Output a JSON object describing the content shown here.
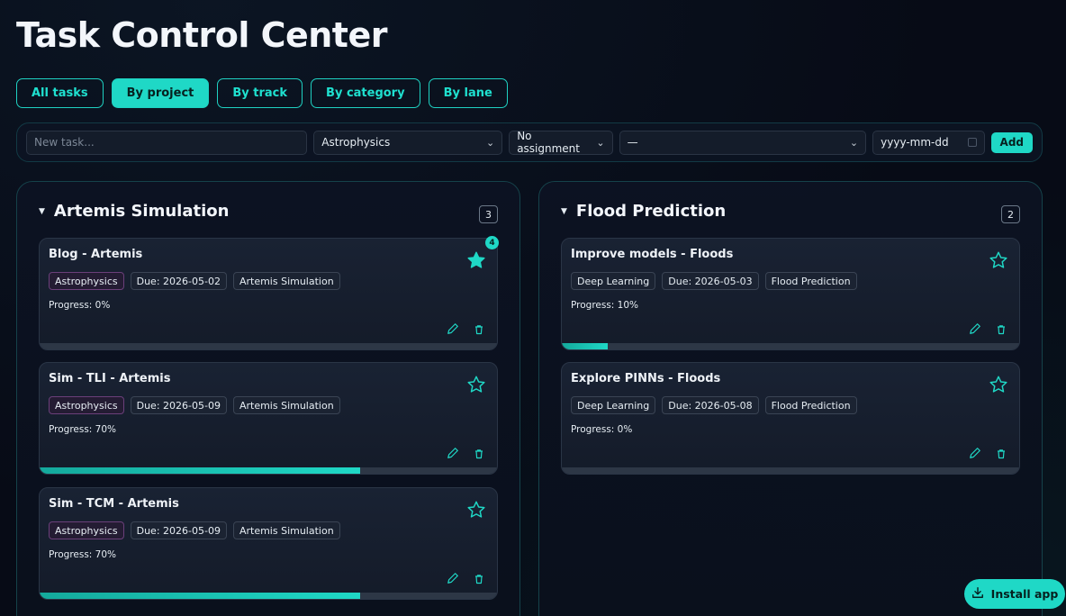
{
  "app": {
    "title": "Task Control Center"
  },
  "view_tabs": [
    {
      "label": "All tasks",
      "active": false
    },
    {
      "label": "By project",
      "active": true
    },
    {
      "label": "By track",
      "active": false
    },
    {
      "label": "By category",
      "active": false
    },
    {
      "label": "By lane",
      "active": false
    }
  ],
  "add_bar": {
    "task_placeholder": "New task...",
    "category_value": "Astrophysics",
    "assignment_value": "No assignment",
    "project_value": "—",
    "date_placeholder": "yyyy-mm-dd",
    "add_label": "Add"
  },
  "columns": [
    {
      "title": "Artemis Simulation",
      "count": "3",
      "cards": [
        {
          "title": "Blog - Artemis",
          "category": "Astrophysics",
          "due": "Due: 2026-05-02",
          "project": "Artemis Simulation",
          "progress_text": "Progress: 0%",
          "progress": 0,
          "starred": true,
          "badge": "4"
        },
        {
          "title": "Sim - TLI - Artemis",
          "category": "Astrophysics",
          "due": "Due: 2026-05-09",
          "project": "Artemis Simulation",
          "progress_text": "Progress: 70%",
          "progress": 70,
          "starred": false
        },
        {
          "title": "Sim - TCM - Artemis",
          "category": "Astrophysics",
          "due": "Due: 2026-05-09",
          "project": "Artemis Simulation",
          "progress_text": "Progress: 70%",
          "progress": 70,
          "starred": false
        }
      ]
    },
    {
      "title": "Flood Prediction",
      "count": "2",
      "cards": [
        {
          "title": "Improve models - Floods",
          "category": "Deep Learning",
          "due": "Due: 2026-05-03",
          "project": "Flood Prediction",
          "progress_text": "Progress: 10%",
          "progress": 10,
          "starred": false
        },
        {
          "title": "Explore PINNs - Floods",
          "category": "Deep Learning",
          "due": "Due: 2026-05-08",
          "project": "Flood Prediction",
          "progress_text": "Progress: 0%",
          "progress": 0,
          "starred": false
        }
      ]
    }
  ],
  "install": {
    "label": "Install app"
  },
  "colors": {
    "accent": "#1fd8c6",
    "background": "#070b16",
    "card": "#192233"
  },
  "icons": {
    "star": "star-icon",
    "edit": "pencil-icon",
    "delete": "trash-icon",
    "install": "download-icon",
    "caret": "caret-down-icon"
  }
}
